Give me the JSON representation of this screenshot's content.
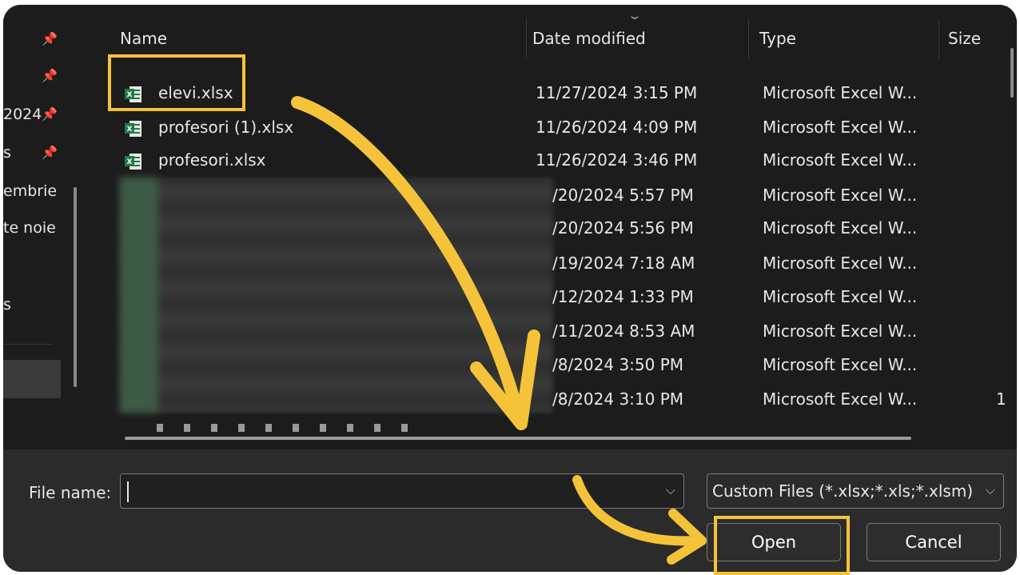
{
  "sidebar": {
    "items": [
      {
        "label": "",
        "pinned": true
      },
      {
        "label": "",
        "pinned": true
      },
      {
        "label": "2024",
        "pinned": true
      },
      {
        "label": "s",
        "pinned": true
      },
      {
        "label": "embrie",
        "pinned": false
      },
      {
        "label": "te noie",
        "pinned": false
      },
      {
        "label": "s",
        "pinned": false
      }
    ]
  },
  "file_list": {
    "columns": {
      "name": "Name",
      "date": "Date modified",
      "type": "Type",
      "size": "Size"
    },
    "rows": [
      {
        "name": "elevi.xlsx",
        "date": "11/27/2024 3:15 PM",
        "type": "Microsoft Excel W...",
        "size": ""
      },
      {
        "name": "profesori (1).xlsx",
        "date": "11/26/2024 4:09 PM",
        "type": "Microsoft Excel W...",
        "size": ""
      },
      {
        "name": "profesori.xlsx",
        "date": "11/26/2024 3:46 PM",
        "type": "Microsoft Excel W...",
        "size": ""
      }
    ],
    "redacted_rows": [
      {
        "date": "/20/2024 5:57 PM",
        "type": "Microsoft Excel W...",
        "size": ""
      },
      {
        "date": "/20/2024 5:56 PM",
        "type": "Microsoft Excel W...",
        "size": ""
      },
      {
        "date": "/19/2024 7:18 AM",
        "type": "Microsoft Excel W...",
        "size": ""
      },
      {
        "date": "/12/2024 1:33 PM",
        "type": "Microsoft Excel W...",
        "size": ""
      },
      {
        "date": "/11/2024 8:53 AM",
        "type": "Microsoft Excel W...",
        "size": ""
      },
      {
        "date": "/8/2024 3:50 PM",
        "type": "Microsoft Excel W...",
        "size": ""
      },
      {
        "date": "/8/2024 3:10 PM",
        "type": "Microsoft Excel W...",
        "size": "1"
      }
    ]
  },
  "bottom": {
    "file_name_label": "File name:",
    "file_name_value": "",
    "filter_value": "Custom Files (*.xlsx;*.xls;*.xlsm)",
    "open_label": "Open",
    "cancel_label": "Cancel"
  },
  "annotations": {
    "color": "#f5c33a",
    "highlighted_file": "elevi.xlsx",
    "highlighted_button": "Open"
  },
  "colors": {
    "background": "#1c1c1c",
    "bottom_panel": "#2b2b2b",
    "excel_green": "#1f7a45"
  },
  "icons": {
    "pin": "pin-icon",
    "excel": "excel-file-icon",
    "dropdown": "chevron-down-icon"
  }
}
